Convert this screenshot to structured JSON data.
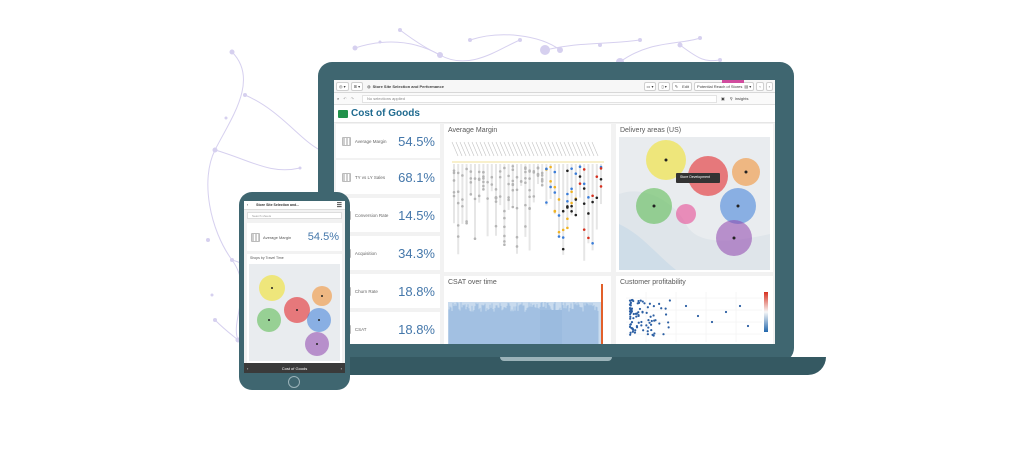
{
  "app": {
    "window_title": "Store Site Selection and Performance",
    "edit_label": "Edit",
    "story_label": "Potential Reach of Stores",
    "selections_label": "No selections applied",
    "insights_label": "Insights",
    "sheet_title": "Cost of Goods"
  },
  "kpis": [
    {
      "label": "Average Margin",
      "value": "54.5%"
    },
    {
      "label": "TY vs LY Sales",
      "value": "68.1%"
    },
    {
      "label": "Conversion Rate",
      "value": "14.5%"
    },
    {
      "label": "Acquisition",
      "value": "34.3%"
    },
    {
      "label": "Churn Rate",
      "value": "18.8%"
    },
    {
      "label": "CSAT",
      "value": "18.8%"
    }
  ],
  "panels": {
    "average_margin": "Average Margin",
    "delivery_areas": "Delivery areas (US)",
    "csat_over_time": "CSAT over time",
    "customer_profitability": "Customer profitability"
  },
  "map_tooltip": "Store Development",
  "phone": {
    "title": "Store Site Selection and...",
    "search_placeholder": "Search sheets",
    "kpi_label": "Average Margin",
    "kpi_value": "54.5%",
    "map_title": "Shops by Travel Time",
    "bottom_title": "Cost of Goods"
  },
  "colors": {
    "device_frame": "#3f6670",
    "accent_blue": "#4477aa",
    "sheet_title": "#1f6a8f",
    "sheet_icon": "#22924b",
    "network": "#c9c2ea"
  }
}
